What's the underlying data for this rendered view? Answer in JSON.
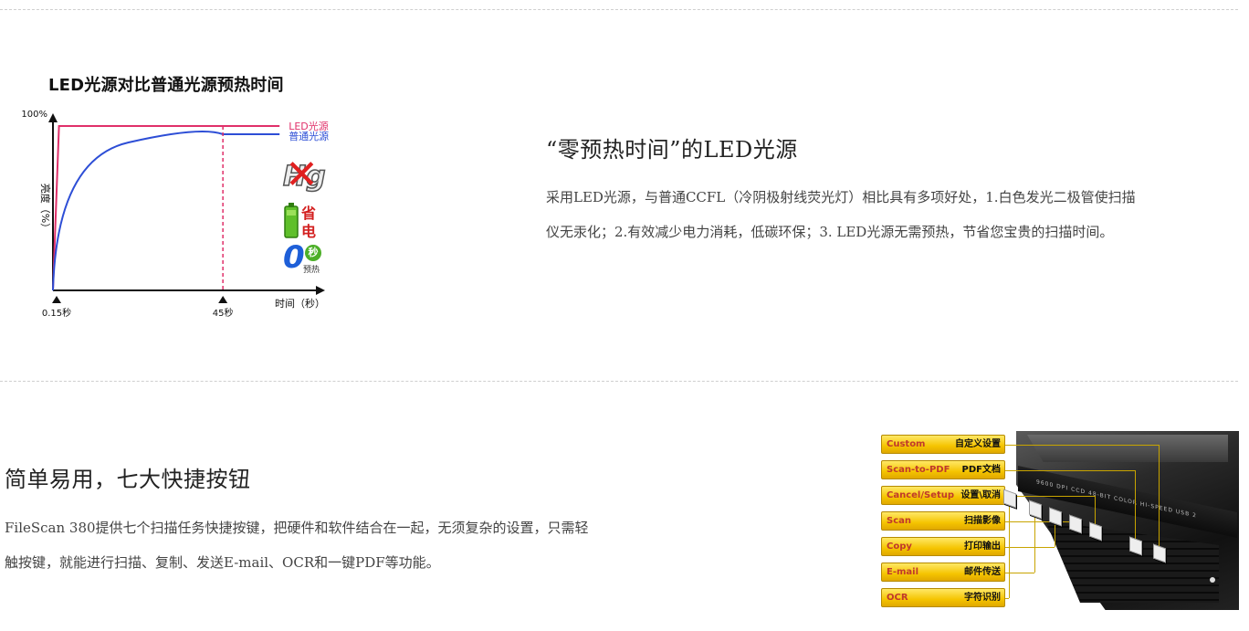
{
  "section1": {
    "chart": {
      "title": "LED光源对比普通光源预热时间",
      "ytick_top": "100%",
      "ylabel": "亮度（%）",
      "xlabel": "时间（秒）",
      "xticks": [
        "0.15秒",
        "45秒"
      ],
      "legend": {
        "led": "LED光源",
        "normal": "普通光源"
      },
      "icons": {
        "battery_text_1": "省",
        "battery_text_2": "电",
        "zero": "0",
        "zero_sec": "秒",
        "zero_warm": "预热"
      }
    },
    "chart_data": {
      "type": "line",
      "title": "LED光源对比普通光源预热时间",
      "xlabel": "时间（秒）",
      "ylabel": "亮度（%）",
      "series": [
        {
          "name": "LED光源",
          "color": "#e0306a",
          "points": [
            [
              0,
              0
            ],
            [
              0.15,
              100
            ],
            [
              45,
              100
            ],
            [
              60,
              100
            ]
          ]
        },
        {
          "name": "普通光源",
          "color": "#2d4ed6",
          "points": [
            [
              0,
              0
            ],
            [
              5,
              40
            ],
            [
              10,
              62
            ],
            [
              15,
              76
            ],
            [
              20,
              85
            ],
            [
              25,
              90
            ],
            [
              30,
              93
            ],
            [
              35,
              94.5
            ],
            [
              40,
              95
            ],
            [
              45,
              95
            ],
            [
              60,
              95
            ]
          ]
        }
      ],
      "markers": [
        0.15,
        45
      ],
      "xlim": [
        0,
        60
      ],
      "ylim": [
        0,
        100
      ]
    },
    "heading": "“零预热时间”的LED光源",
    "para_line1": "采用LED光源，与普通CCFL（冷阴极射线荧光灯）相比具有多项好处，1.白色发光二极管使扫描",
    "para_line2": "仪无汞化；2.有效减少电力消耗，低碳环保；3. LED光源无需预热，节省您宝贵的扫描时间。"
  },
  "section2": {
    "heading": "简单易用，七大快捷按钮",
    "para_line1": "FileScan 380提供七个扫描任务快捷按键，把硬件和软件结合在一起，无须复杂的设置，只需轻",
    "para_line2": "触按键，就能进行扫描、复制、发送E-mail、OCR和一键PDF等功能。",
    "device_print": "9600 DPI CCD   48-BIT COLOR   HI-SPEED USB 2",
    "buttons": [
      {
        "en": "Custom",
        "cn": "自定义设置"
      },
      {
        "en": "Scan-to-PDF",
        "cn": "PDF文档"
      },
      {
        "en": "Cancel/Setup",
        "cn": "设置\\取消"
      },
      {
        "en": "Scan",
        "cn": "扫描影像"
      },
      {
        "en": "Copy",
        "cn": "打印输出"
      },
      {
        "en": "E-mail",
        "cn": "邮件传送"
      },
      {
        "en": "OCR",
        "cn": "字符识别"
      }
    ]
  }
}
